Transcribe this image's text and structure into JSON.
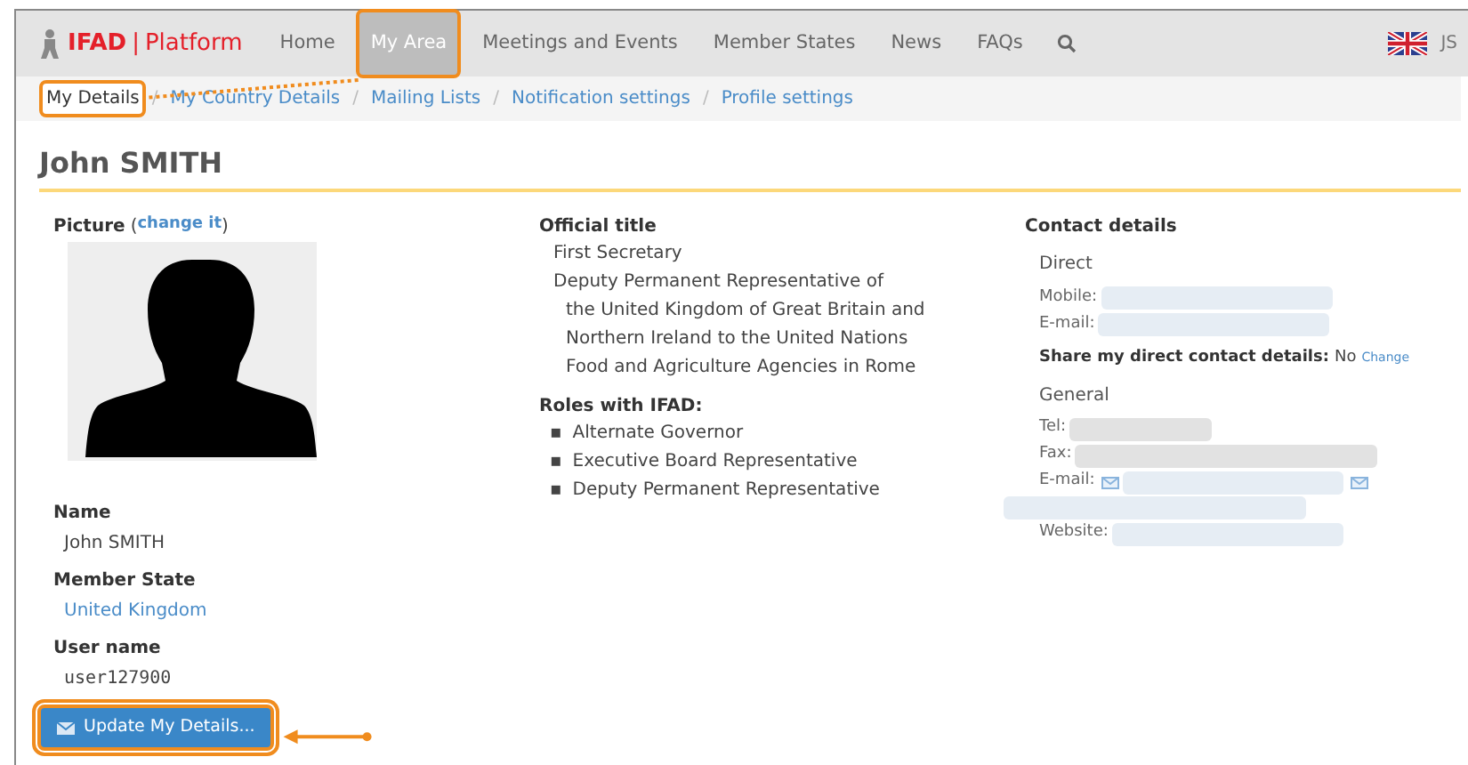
{
  "navbar": {
    "brand": "IFAD",
    "separator": "|",
    "product": "Platform",
    "items": [
      {
        "label": "Home",
        "selected": false,
        "highlighted": false
      },
      {
        "label": "My Area",
        "selected": true,
        "highlighted": true
      },
      {
        "label": "Meetings and Events",
        "selected": false,
        "highlighted": false
      },
      {
        "label": "Member States",
        "selected": false,
        "highlighted": false
      },
      {
        "label": "News",
        "selected": false,
        "highlighted": false
      },
      {
        "label": "FAQs",
        "selected": false,
        "highlighted": false
      }
    ],
    "user": "JS"
  },
  "subnav": [
    {
      "label": "My Details",
      "selected": true,
      "highlighted": true
    },
    {
      "label": "My Country Details",
      "selected": false,
      "highlighted": false
    },
    {
      "label": "Mailing Lists",
      "selected": false,
      "highlighted": false
    },
    {
      "label": "Notification settings",
      "selected": false,
      "highlighted": false
    },
    {
      "label": "Profile settings",
      "selected": false,
      "highlighted": false
    }
  ],
  "subnav_separator": "/",
  "page_title": "John SMITH",
  "picture": {
    "label": "Picture",
    "open": "(",
    "link": "change it",
    "close": ")"
  },
  "fields": [
    {
      "label": "Name",
      "value": "John SMITH",
      "kind": "text"
    },
    {
      "label": "Member State",
      "value": "United Kingdom",
      "kind": "link"
    },
    {
      "label": "User name",
      "value": "user127900",
      "kind": "mono"
    }
  ],
  "update_button": {
    "label": "Update My Details...",
    "highlighted": true
  },
  "official_title": {
    "heading": "Official title",
    "titles": [
      {
        "text": "First Secretary"
      },
      {
        "text": "Deputy Permanent Representative of",
        "continuation": [
          "the United Kingdom of Great Britain and",
          "Northern Ireland to the United Nations",
          "Food and Agriculture Agencies in Rome"
        ]
      }
    ]
  },
  "roles": {
    "heading": "Roles with IFAD:",
    "marker": "▪",
    "items": [
      "Alternate Governor",
      "Executive Board Representative",
      "Deputy Permanent Representative"
    ]
  },
  "contact": {
    "heading": "Contact details",
    "groups": [
      {
        "title": "Direct",
        "rows": [
          {
            "label": "Mobile:",
            "kind": "plain"
          },
          {
            "label": "E-mail:",
            "kind": "plain"
          }
        ],
        "share": {
          "label": "Share my direct contact details:",
          "value": "No",
          "link": "Change"
        }
      },
      {
        "title": "General",
        "rows": [
          {
            "label": "Tel:",
            "kind": "plain"
          },
          {
            "label": "Fax:",
            "kind": "wide"
          },
          {
            "label": "E-mail:",
            "kind": "email"
          },
          {
            "label": "",
            "kind": "blank"
          },
          {
            "label": "Website:",
            "kind": "plain"
          }
        ]
      }
    ]
  }
}
